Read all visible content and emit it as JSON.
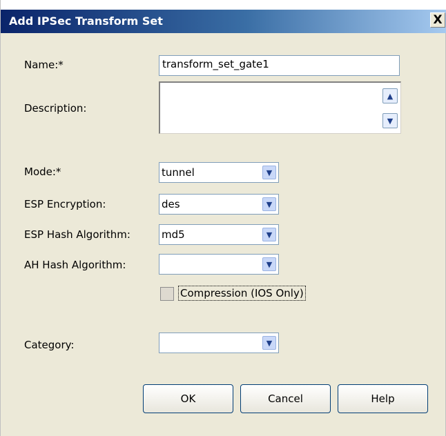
{
  "dialog": {
    "title": "Add IPSec Transform Set",
    "close_label": "X"
  },
  "fields": {
    "name_label": "Name:*",
    "name_value": "transform_set_gate1",
    "description_label": "Description:",
    "description_value": "",
    "mode_label": "Mode:*",
    "mode_value": "tunnel",
    "esp_encryption_label": "ESP Encryption:",
    "esp_encryption_value": "des",
    "esp_hash_label": "ESP Hash Algorithm:",
    "esp_hash_value": "md5",
    "ah_hash_label": "AH Hash Algorithm:",
    "ah_hash_value": "",
    "compression_label": "Compression (IOS Only)",
    "compression_checked": false,
    "category_label": "Category:",
    "category_value": ""
  },
  "buttons": {
    "ok": "OK",
    "cancel": "Cancel",
    "help": "Help"
  },
  "icons": {
    "scroll_up": "scroll-up-icon",
    "scroll_down": "scroll-down-icon",
    "dropdown": "chevron-down-icon"
  }
}
